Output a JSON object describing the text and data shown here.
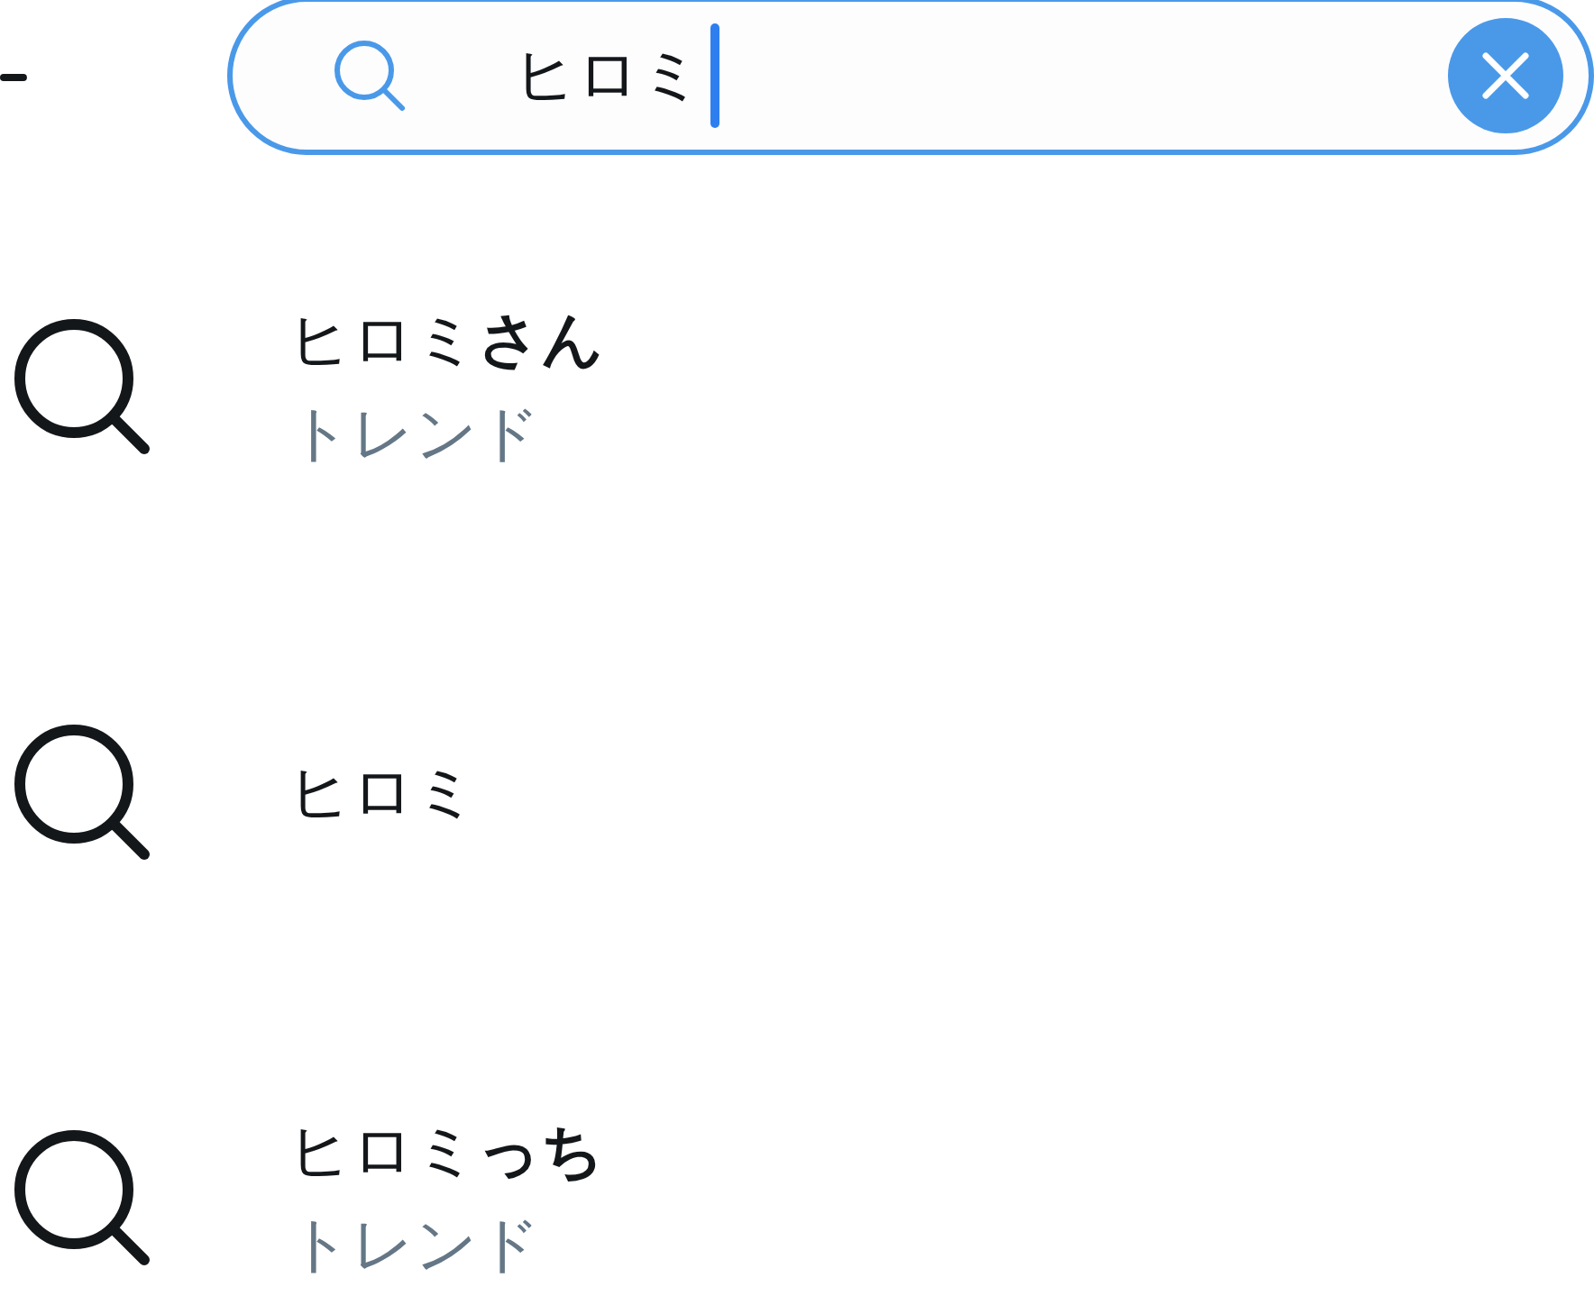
{
  "search": {
    "value": "ヒロミ"
  },
  "suggestions": [
    {
      "text": "ヒロミ**さん**",
      "subtitle": "トレンド"
    },
    {
      "text": "ヒロミ"
    },
    {
      "text": "ヒロミ**っち**",
      "subtitle": "トレンド"
    }
  ]
}
